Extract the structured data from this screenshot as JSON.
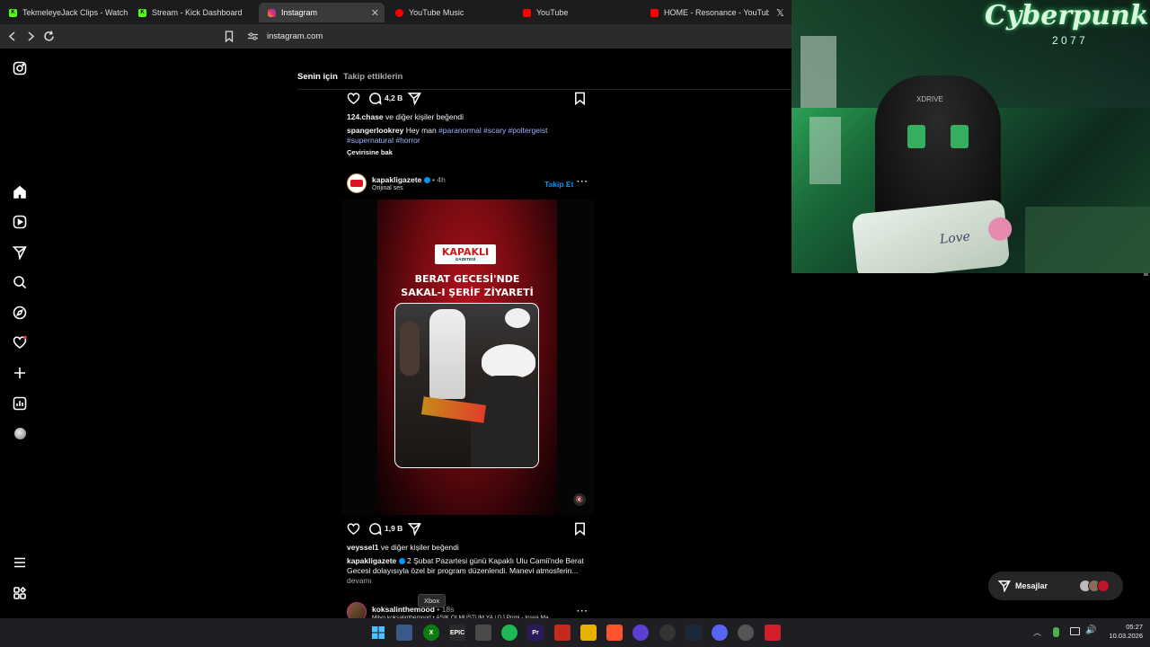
{
  "tabs": [
    {
      "label": "TekmeleyeJack Clips - Watch Li",
      "icon": "kick-icon",
      "color": "#53fc18"
    },
    {
      "label": "Stream - Kick Dashboard",
      "icon": "kick-icon",
      "color": "#53fc18"
    },
    {
      "label": "Instagram",
      "icon": "instagram-icon",
      "color": "#e1306c"
    },
    {
      "label": "YouTube Music",
      "icon": "youtube-music-icon",
      "color": "#ff0000"
    },
    {
      "label": "YouTube",
      "icon": "youtube-icon",
      "color": "#ff0000"
    },
    {
      "label": "HOME - Resonance - YouTube",
      "icon": "youtube-icon",
      "color": "#ff0000"
    }
  ],
  "address": {
    "url": "instagram.com"
  },
  "feed_tabs": {
    "for_you": "Senin için",
    "following": "Takip ettiklerin"
  },
  "post1": {
    "comments": "4,2 B",
    "liked_by_user": "124.chase",
    "liked_by_rest": "ve diğer kişiler beğendi",
    "caption_user": "spangerlookrey",
    "caption_text": "Hey man",
    "hashtags_line1": "#paranormal #scary #poltergeist",
    "hashtags_line2": "#supernatural #horror",
    "see_translation": "Çevirisine bak"
  },
  "post2": {
    "username": "kapakligazete",
    "time": "• 4h",
    "audio": "Orijinal ses",
    "follow": "Takip Et",
    "logo_text": "KAPAKLI",
    "logo_sub": "GAZETESİ",
    "headline1": "BERAT GECESİ'NDE",
    "headline2": "SAKAL-I ŞERİF ZİYARETİ",
    "comments": "1,9 B",
    "liked_by_user": "veyssel1",
    "liked_by_rest": "ve diğer kişiler beğendi",
    "caption_user": "kapakligazete",
    "caption_line1": "2 Şubat Pazartesi günü Kapaklı Ulu Camii'nde Berat",
    "caption_line2": "Gecesi dolayısıyla özel bir program düzenlendi. Manevi atmosferin...",
    "more": "devamı"
  },
  "post3": {
    "username": "koksalinthemood",
    "time": "• 18s",
    "audio": "Milyo koksalinthemood • AŞIK OLMUŞTUM YA | DJ Primi - Insya Ma"
  },
  "tooltip": "Xbox",
  "messages": {
    "label": "Mesajlar"
  },
  "webcam": {
    "sign": "Cyberpunk",
    "sign_year": "2 0 7 7",
    "chair_brand": "XDRIVE",
    "pillow_text": "Love"
  },
  "taskbar": {
    "time": "05:27",
    "date": "10.03.2026"
  },
  "colors": {
    "accent": "#0095f6",
    "link": "#a0b4ff",
    "webcam_green": "#3bd26f"
  }
}
